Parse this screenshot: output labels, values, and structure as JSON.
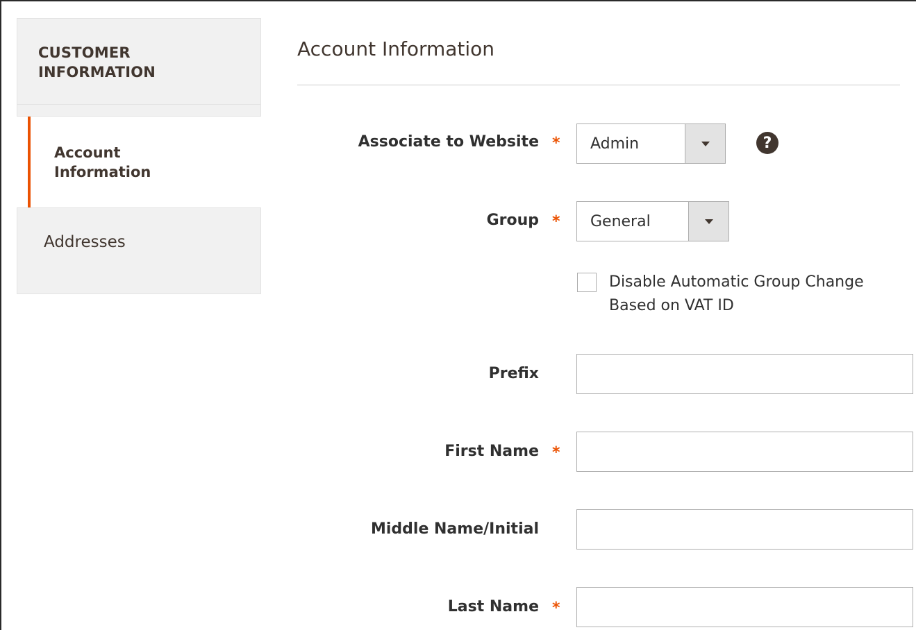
{
  "sidebar": {
    "header_line1": "CUSTOMER",
    "header_line2": "INFORMATION",
    "items": [
      {
        "label_line1": "Account",
        "label_line2": "Information",
        "active": true
      },
      {
        "label": "Addresses",
        "active": false
      }
    ]
  },
  "main": {
    "title": "Account Information",
    "required_marker": "*",
    "fields": {
      "website": {
        "label": "Associate to Website",
        "value": "Admin",
        "required": true
      },
      "group": {
        "label": "Group",
        "value": "General",
        "required": true
      },
      "disable_group_change": {
        "label_line1": "Disable Automatic Group Change",
        "label_line2": "Based on VAT ID",
        "checked": false
      },
      "prefix": {
        "label": "Prefix",
        "value": "",
        "required": false
      },
      "first_name": {
        "label": "First Name",
        "value": "",
        "required": true
      },
      "middle_name": {
        "label": "Middle Name/Initial",
        "value": "",
        "required": false
      },
      "last_name": {
        "label": "Last Name",
        "value": "",
        "required": true
      }
    },
    "help_glyph": "?"
  },
  "colors": {
    "accent": "#eb5202",
    "text_dark": "#41362f",
    "panel_bg": "#f1f1f1"
  },
  "icons": {
    "help": "question-circle-icon",
    "dropdown": "caret-down-icon"
  }
}
